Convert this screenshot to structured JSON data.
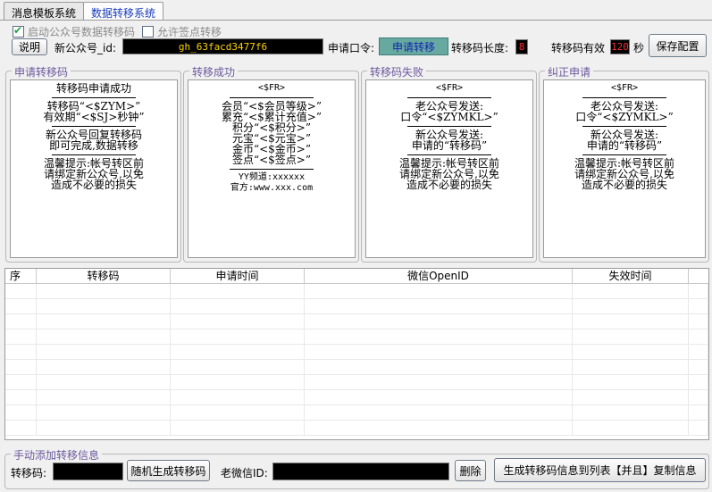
{
  "tabs": [
    {
      "label": "消息模板系统"
    },
    {
      "label": "数据转移系统"
    }
  ],
  "options": {
    "enable_label": "启动公众号数据转移码",
    "allow_label": "允许签点转移"
  },
  "toolbar": {
    "help_label": "说明",
    "appid_label": "新公众号_id:",
    "appid_value": "gh_63facd3477f6",
    "command_label": "申请口令:",
    "command_value": "申请转移",
    "code_length_label": "转移码长度:",
    "code_length_value": "8",
    "valid_label": "转移码有效",
    "valid_value": "120",
    "valid_unit": "秒",
    "save_label": "保存配置"
  },
  "panels": {
    "apply": {
      "title": "申请转移码",
      "l1": "转移码申请成功",
      "l2": "转移码“<$ZYM>”",
      "l3": "有效期“<$SJ>秒钟”",
      "l4": "新公众号回复转移码",
      "l5": "即可完成,数据转移",
      "l6": "温馨提示:帐号转区前",
      "l7": "请绑定新公众号,以免",
      "l8": "造成不必要的损失"
    },
    "success": {
      "title": "转移成功",
      "l1": "<$FR>",
      "l2": "会员“<$会员等级>”",
      "l3": "累充“<$累计充值>”",
      "l4": "积分“<$积分>”",
      "l5": "元宝“<$元宝>”",
      "l6": "金币“<$金币>”",
      "l7": "签点“<$签点>”",
      "l8": "YY频道:xxxxxx",
      "l9": "官方:www.xxx.com"
    },
    "fail": {
      "title": "转移码失败",
      "l1": "<$FR>",
      "l2": "老公众号发送:",
      "l3": "口令“<$ZYMKL>”",
      "l4": "新公众号发送:",
      "l5": "申请的“转移码”",
      "l6": "温馨提示:帐号转区前",
      "l7": "请绑定新公众号,以免",
      "l8": "造成不必要的损失"
    },
    "correct": {
      "title": "纠正申请",
      "l1": "<$FR>",
      "l2": "老公众号发送:",
      "l3": "口令“<$ZYMKL>”",
      "l4": "新公众号发送:",
      "l5": "申请的“转移码”",
      "l6": "温馨提示:帐号转区前",
      "l7": "请绑定新公众号,以免",
      "l8": "造成不必要的损失"
    }
  },
  "table": {
    "columns": [
      "序",
      "转移码",
      "申请时间",
      "微信OpenID",
      "失效时间"
    ]
  },
  "manual": {
    "title": "手动添加转移信息",
    "code_label": "转移码:",
    "random_label": "随机生成转移码",
    "old_id_label": "老微信ID:",
    "delete_label": "删除",
    "generate_label": "生成转移码信息到列表【并且】复制信息"
  }
}
